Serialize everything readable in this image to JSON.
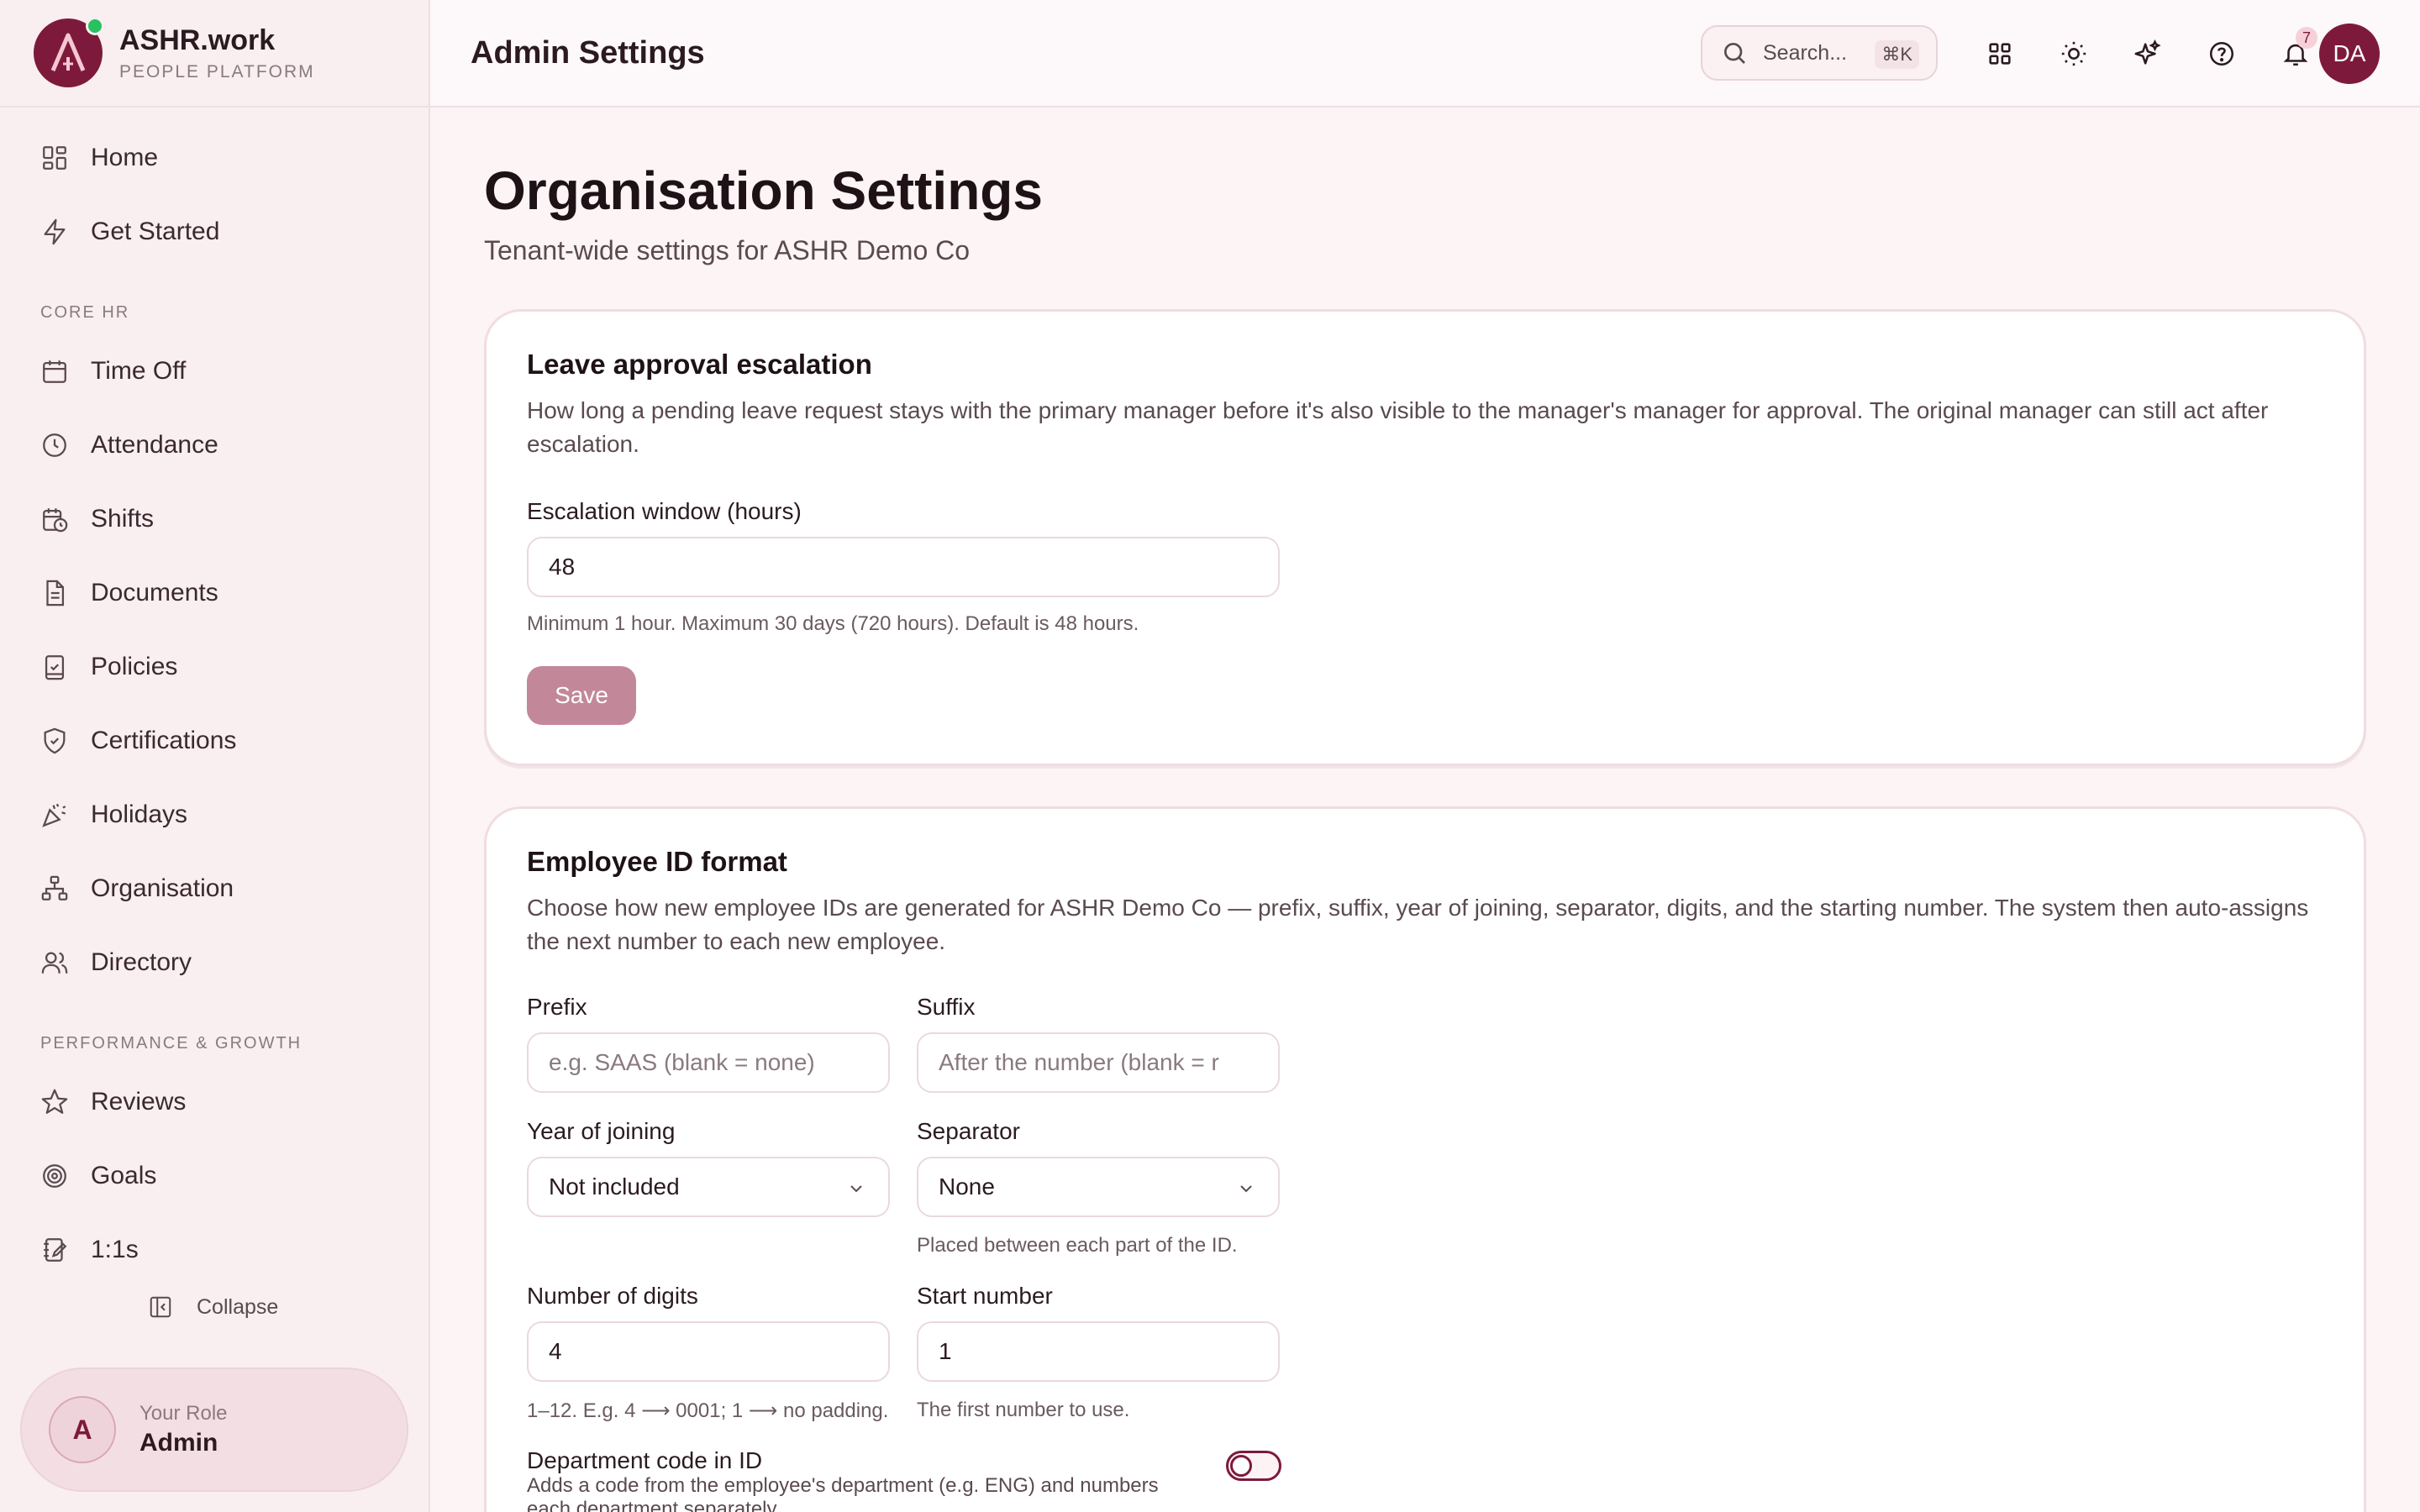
{
  "brand": {
    "name": "ASHR.work",
    "subtitle": "PEOPLE PLATFORM",
    "logo_letter": "A"
  },
  "sidebar": {
    "top_items": [
      {
        "label": "Home",
        "icon": "grid-icon"
      },
      {
        "label": "Get Started",
        "icon": "lightning-icon"
      }
    ],
    "section_core": "CORE HR",
    "core_items": [
      {
        "label": "Time Off",
        "icon": "calendar-icon"
      },
      {
        "label": "Attendance",
        "icon": "clock-icon"
      },
      {
        "label": "Shifts",
        "icon": "calendar-clock-icon"
      },
      {
        "label": "Documents",
        "icon": "document-icon"
      },
      {
        "label": "Policies",
        "icon": "clipboard-check-icon"
      },
      {
        "label": "Certifications",
        "icon": "shield-check-icon"
      },
      {
        "label": "Holidays",
        "icon": "party-icon"
      },
      {
        "label": "Organisation",
        "icon": "org-chart-icon"
      },
      {
        "label": "Directory",
        "icon": "users-icon"
      }
    ],
    "section_perf": "PERFORMANCE & GROWTH",
    "perf_items": [
      {
        "label": "Reviews",
        "icon": "star-icon"
      },
      {
        "label": "Goals",
        "icon": "target-icon"
      },
      {
        "label": "1:1s",
        "icon": "notebook-icon"
      }
    ],
    "collapse_label": "Collapse",
    "role": {
      "avatar_letter": "A",
      "label": "Your Role",
      "value": "Admin"
    }
  },
  "header": {
    "title": "Admin Settings",
    "search_placeholder": "Search...",
    "search_shortcut": "⌘K",
    "notification_count": "7",
    "avatar_initials": "DA"
  },
  "page": {
    "title": "Organisation Settings",
    "subtitle": "Tenant-wide settings for ASHR Demo Co"
  },
  "leave_card": {
    "title": "Leave approval escalation",
    "description": "How long a pending leave request stays with the primary manager before it's also visible to the manager's manager for approval. The original manager can still act after escalation.",
    "field_label": "Escalation window (hours)",
    "field_value": "48",
    "hint": "Minimum 1 hour. Maximum 30 days (720 hours). Default is 48 hours.",
    "save_label": "Save"
  },
  "id_card": {
    "title": "Employee ID format",
    "description": "Choose how new employee IDs are generated for ASHR Demo Co — prefix, suffix, year of joining, separator, digits, and the starting number. The system then auto-assigns the next number to each new employee.",
    "prefix_label": "Prefix",
    "prefix_placeholder": "e.g. SAAS (blank = none)",
    "suffix_label": "Suffix",
    "suffix_placeholder": "After the number (blank = r",
    "year_label": "Year of joining",
    "year_value": "Not included",
    "separator_label": "Separator",
    "separator_value": "None",
    "separator_hint": "Placed between each part of the ID.",
    "digits_label": "Number of digits",
    "digits_value": "4",
    "digits_hint": "1–12. E.g. 4 ⟶ 0001; 1 ⟶ no padding.",
    "start_label": "Start number",
    "start_value": "1",
    "start_hint": "The first number to use.",
    "dept_label": "Department code in ID",
    "dept_desc": "Adds a code from the employee's department (e.g. ENG) and numbers each department separately.",
    "dept_enabled": false
  },
  "colors": {
    "accent": "#7d1a3c",
    "status_online": "#27c160",
    "save_disabled": "#c3879a"
  }
}
